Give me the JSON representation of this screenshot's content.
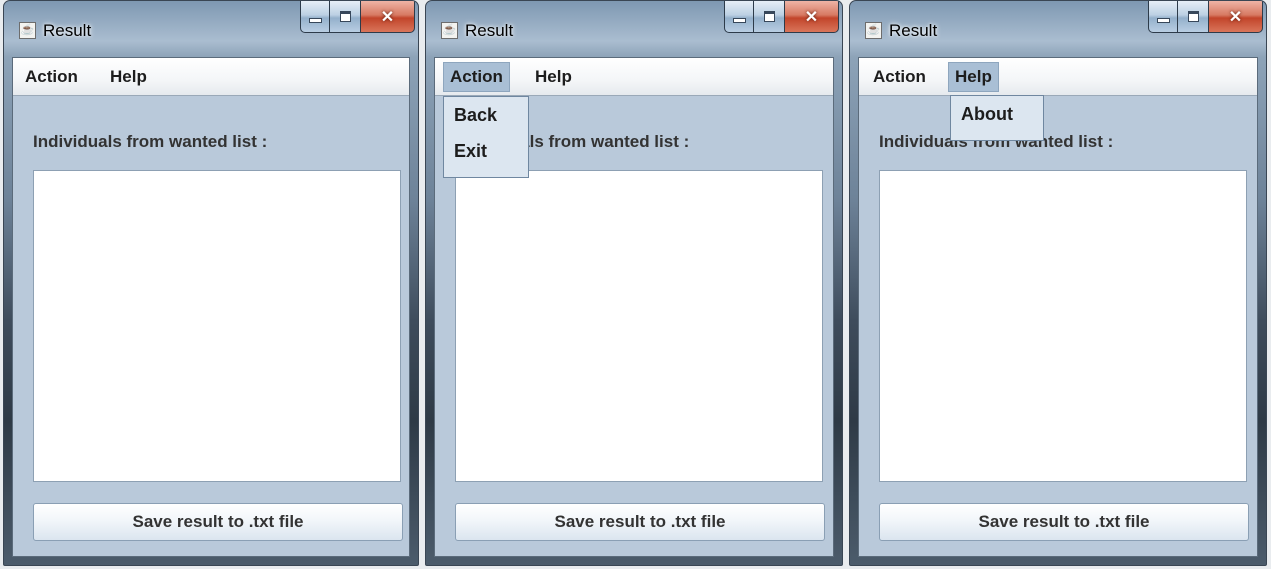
{
  "windows": [
    {
      "title": "Result",
      "menus": [
        {
          "label": "Action"
        },
        {
          "label": "Help"
        }
      ],
      "content_label": "Individuals from wanted list :",
      "save_button": "Save result to .txt file"
    },
    {
      "title": "Result",
      "menus": [
        {
          "label": "Action"
        },
        {
          "label": "Help"
        }
      ],
      "content_label": "Individuals from wanted list :",
      "save_button": "Save result to .txt file",
      "open_menu": "Action",
      "popup_items": [
        "Back",
        "Exit"
      ]
    },
    {
      "title": "Result",
      "menus": [
        {
          "label": "Action"
        },
        {
          "label": "Help"
        }
      ],
      "content_label": "Individuals from wanted list :",
      "save_button": "Save result to .txt file",
      "open_menu": "Help",
      "popup_items": [
        "About"
      ]
    }
  ],
  "icons": {
    "app": "java-coffee-cup-icon",
    "minimize": "minimize-icon",
    "maximize": "maximize-icon",
    "close": "close-icon"
  },
  "colors": {
    "menu_highlight": "#a9bfd5",
    "client_background": "#b9c9da",
    "close_button": "#c2452b"
  }
}
